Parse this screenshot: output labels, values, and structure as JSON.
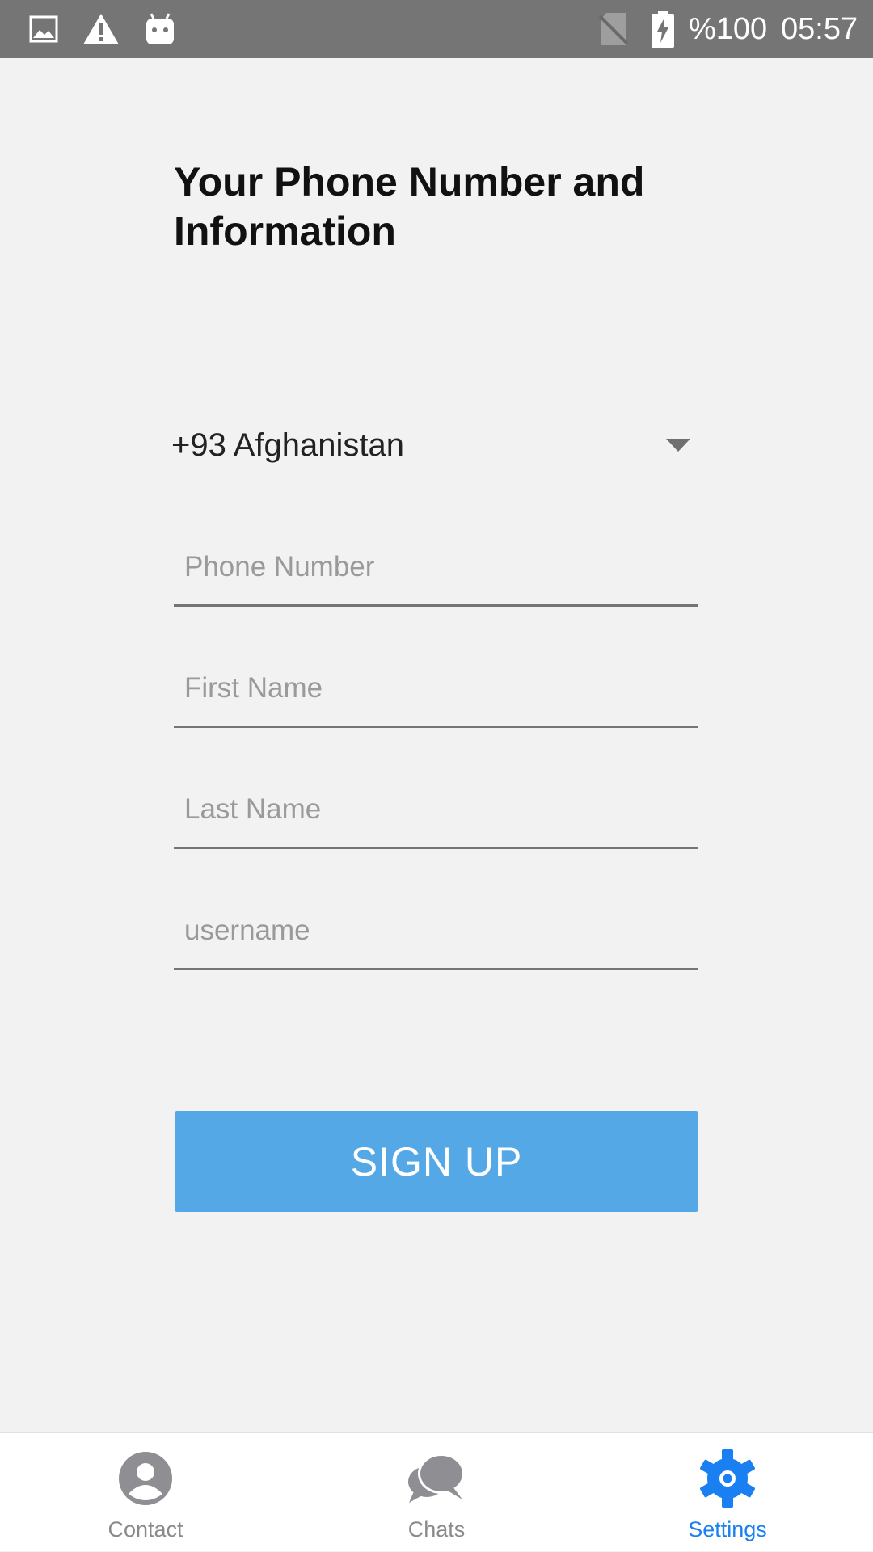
{
  "status_bar": {
    "battery_text": "%100",
    "time": "05:57",
    "icons": [
      "image-icon",
      "warning-icon",
      "android-icon",
      "no-sim-icon",
      "battery-charging-icon"
    ]
  },
  "page": {
    "title": "Your Phone Number and Information"
  },
  "country_select": {
    "selected": "+93 Afghanistan",
    "icon": "dropdown-caret-icon"
  },
  "form": {
    "phone_placeholder": "Phone Number",
    "first_name_placeholder": "First Name",
    "last_name_placeholder": "Last Name",
    "username_placeholder": "username",
    "phone_value": "",
    "first_name_value": "",
    "last_name_value": "",
    "username_value": ""
  },
  "signup": {
    "label": "SIGN UP",
    "color": "#55a8e6"
  },
  "bottom_nav": {
    "items": [
      {
        "label": "Contact",
        "icon": "person-icon",
        "active": false
      },
      {
        "label": "Chats",
        "icon": "chat-bubbles-icon",
        "active": false
      },
      {
        "label": "Settings",
        "icon": "gear-icon",
        "active": true
      }
    ],
    "active_color": "#1a7ff0",
    "inactive_color": "#8a8a8a"
  }
}
